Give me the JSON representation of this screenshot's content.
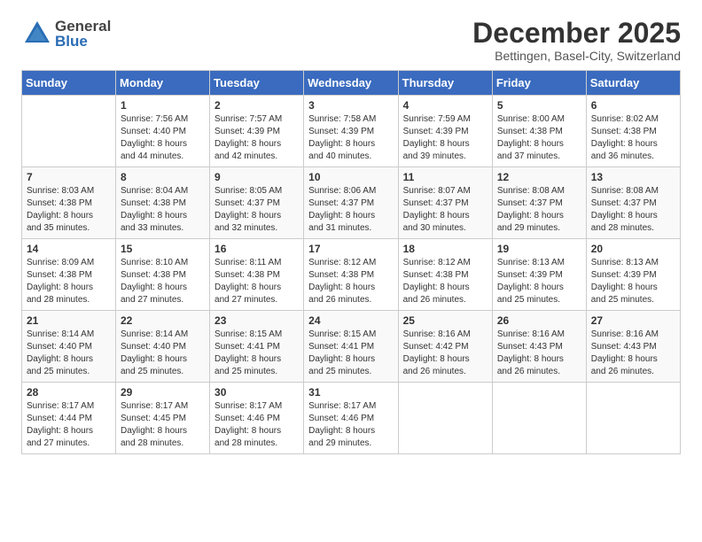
{
  "header": {
    "logo_general": "General",
    "logo_blue": "Blue",
    "month": "December 2025",
    "location": "Bettingen, Basel-City, Switzerland"
  },
  "weekdays": [
    "Sunday",
    "Monday",
    "Tuesday",
    "Wednesday",
    "Thursday",
    "Friday",
    "Saturday"
  ],
  "weeks": [
    [
      {
        "day": "",
        "info": ""
      },
      {
        "day": "1",
        "info": "Sunrise: 7:56 AM\nSunset: 4:40 PM\nDaylight: 8 hours\nand 44 minutes."
      },
      {
        "day": "2",
        "info": "Sunrise: 7:57 AM\nSunset: 4:39 PM\nDaylight: 8 hours\nand 42 minutes."
      },
      {
        "day": "3",
        "info": "Sunrise: 7:58 AM\nSunset: 4:39 PM\nDaylight: 8 hours\nand 40 minutes."
      },
      {
        "day": "4",
        "info": "Sunrise: 7:59 AM\nSunset: 4:39 PM\nDaylight: 8 hours\nand 39 minutes."
      },
      {
        "day": "5",
        "info": "Sunrise: 8:00 AM\nSunset: 4:38 PM\nDaylight: 8 hours\nand 37 minutes."
      },
      {
        "day": "6",
        "info": "Sunrise: 8:02 AM\nSunset: 4:38 PM\nDaylight: 8 hours\nand 36 minutes."
      }
    ],
    [
      {
        "day": "7",
        "info": "Sunrise: 8:03 AM\nSunset: 4:38 PM\nDaylight: 8 hours\nand 35 minutes."
      },
      {
        "day": "8",
        "info": "Sunrise: 8:04 AM\nSunset: 4:38 PM\nDaylight: 8 hours\nand 33 minutes."
      },
      {
        "day": "9",
        "info": "Sunrise: 8:05 AM\nSunset: 4:37 PM\nDaylight: 8 hours\nand 32 minutes."
      },
      {
        "day": "10",
        "info": "Sunrise: 8:06 AM\nSunset: 4:37 PM\nDaylight: 8 hours\nand 31 minutes."
      },
      {
        "day": "11",
        "info": "Sunrise: 8:07 AM\nSunset: 4:37 PM\nDaylight: 8 hours\nand 30 minutes."
      },
      {
        "day": "12",
        "info": "Sunrise: 8:08 AM\nSunset: 4:37 PM\nDaylight: 8 hours\nand 29 minutes."
      },
      {
        "day": "13",
        "info": "Sunrise: 8:08 AM\nSunset: 4:37 PM\nDaylight: 8 hours\nand 28 minutes."
      }
    ],
    [
      {
        "day": "14",
        "info": "Sunrise: 8:09 AM\nSunset: 4:38 PM\nDaylight: 8 hours\nand 28 minutes."
      },
      {
        "day": "15",
        "info": "Sunrise: 8:10 AM\nSunset: 4:38 PM\nDaylight: 8 hours\nand 27 minutes."
      },
      {
        "day": "16",
        "info": "Sunrise: 8:11 AM\nSunset: 4:38 PM\nDaylight: 8 hours\nand 27 minutes."
      },
      {
        "day": "17",
        "info": "Sunrise: 8:12 AM\nSunset: 4:38 PM\nDaylight: 8 hours\nand 26 minutes."
      },
      {
        "day": "18",
        "info": "Sunrise: 8:12 AM\nSunset: 4:38 PM\nDaylight: 8 hours\nand 26 minutes."
      },
      {
        "day": "19",
        "info": "Sunrise: 8:13 AM\nSunset: 4:39 PM\nDaylight: 8 hours\nand 25 minutes."
      },
      {
        "day": "20",
        "info": "Sunrise: 8:13 AM\nSunset: 4:39 PM\nDaylight: 8 hours\nand 25 minutes."
      }
    ],
    [
      {
        "day": "21",
        "info": "Sunrise: 8:14 AM\nSunset: 4:40 PM\nDaylight: 8 hours\nand 25 minutes."
      },
      {
        "day": "22",
        "info": "Sunrise: 8:14 AM\nSunset: 4:40 PM\nDaylight: 8 hours\nand 25 minutes."
      },
      {
        "day": "23",
        "info": "Sunrise: 8:15 AM\nSunset: 4:41 PM\nDaylight: 8 hours\nand 25 minutes."
      },
      {
        "day": "24",
        "info": "Sunrise: 8:15 AM\nSunset: 4:41 PM\nDaylight: 8 hours\nand 25 minutes."
      },
      {
        "day": "25",
        "info": "Sunrise: 8:16 AM\nSunset: 4:42 PM\nDaylight: 8 hours\nand 26 minutes."
      },
      {
        "day": "26",
        "info": "Sunrise: 8:16 AM\nSunset: 4:43 PM\nDaylight: 8 hours\nand 26 minutes."
      },
      {
        "day": "27",
        "info": "Sunrise: 8:16 AM\nSunset: 4:43 PM\nDaylight: 8 hours\nand 26 minutes."
      }
    ],
    [
      {
        "day": "28",
        "info": "Sunrise: 8:17 AM\nSunset: 4:44 PM\nDaylight: 8 hours\nand 27 minutes."
      },
      {
        "day": "29",
        "info": "Sunrise: 8:17 AM\nSunset: 4:45 PM\nDaylight: 8 hours\nand 28 minutes."
      },
      {
        "day": "30",
        "info": "Sunrise: 8:17 AM\nSunset: 4:46 PM\nDaylight: 8 hours\nand 28 minutes."
      },
      {
        "day": "31",
        "info": "Sunrise: 8:17 AM\nSunset: 4:46 PM\nDaylight: 8 hours\nand 29 minutes."
      },
      {
        "day": "",
        "info": ""
      },
      {
        "day": "",
        "info": ""
      },
      {
        "day": "",
        "info": ""
      }
    ]
  ]
}
